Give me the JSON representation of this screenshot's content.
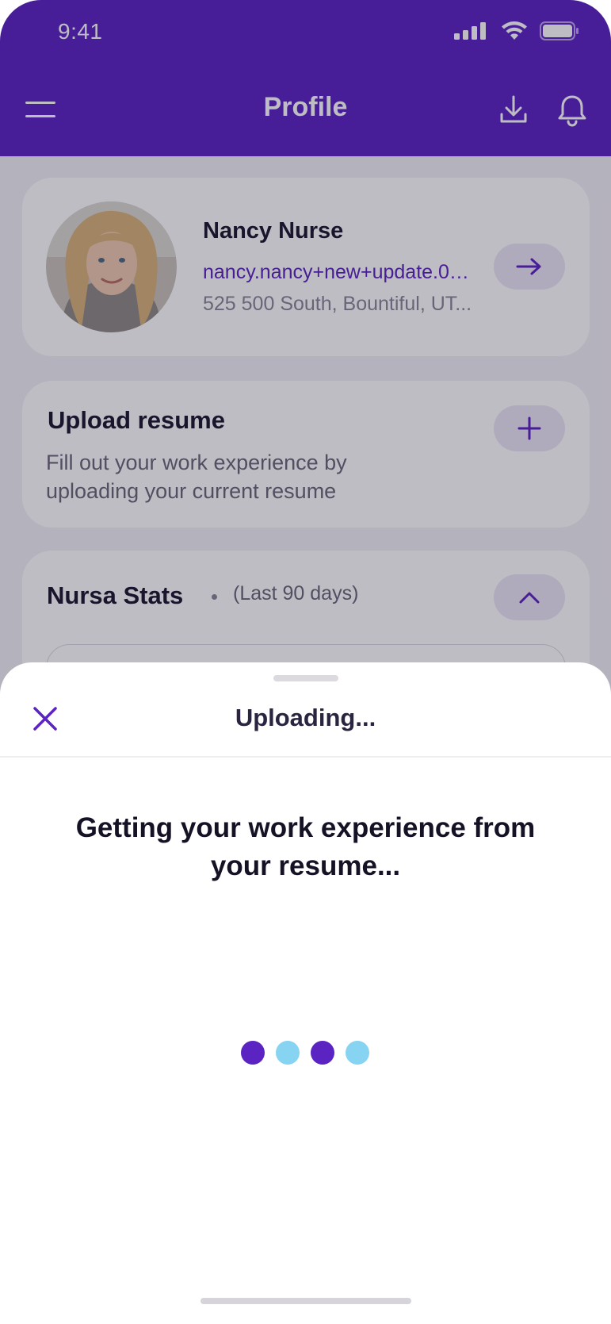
{
  "status_bar": {
    "time": "9:41"
  },
  "header": {
    "title": "Profile",
    "icons": [
      "menu-icon",
      "download-icon",
      "bell-icon"
    ]
  },
  "profile": {
    "name": "Nancy Nurse",
    "email": "nancy.nancy+new+update.01...",
    "address": "525 500 South, Bountiful, UT..."
  },
  "upload_resume": {
    "title": "Upload resume",
    "description": "Fill out your work experience by uploading your current resume"
  },
  "stats": {
    "title": "Nursa Stats",
    "period": "(Last 90 days)"
  },
  "sheet": {
    "title": "Uploading...",
    "message": "Getting your work experience from your resume..."
  },
  "loader": {
    "dot_colors": [
      "#5b23c2",
      "#86d3f2",
      "#5b23c2",
      "#86d3f2"
    ]
  },
  "colors": {
    "brand": "#5b23c2",
    "loader_accent": "#86d3f2",
    "text_dark": "#1c1630",
    "text_muted": "#6b6678"
  }
}
